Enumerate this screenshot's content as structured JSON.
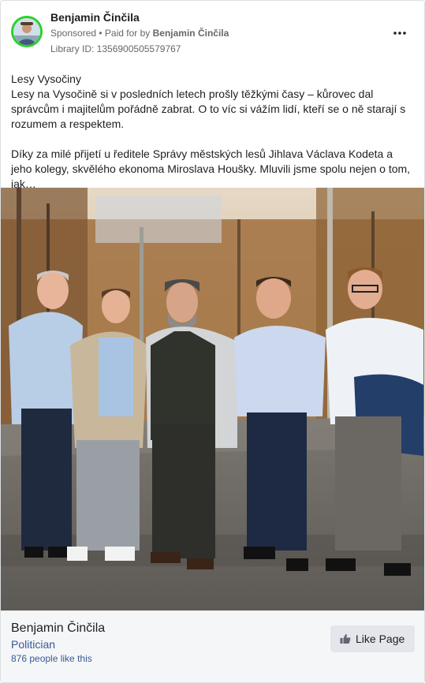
{
  "post": {
    "author": "Benjamin Činčila",
    "sponsored": "Sponsored",
    "separator": " • ",
    "paid_prefix": "Paid for by ",
    "paid_by": "Benjamin Činčila",
    "library_id": "Library ID: 1356900505579767",
    "text_title": "Lesy Vysočiny",
    "text_para1": "Lesy na Vysočině si v posledních letech prošly těžkými časy – kůrovec dal správcům i majitelům pořádně zabrat. O to víc si vážím lidí, kteří se o ně starají s rozumem a respektem.",
    "text_para2": "Díky za milé přijetí u ředitele Správy městských lesů Jihlava Václava Kodeta a jeho kolegy, skvělého ekonoma Miroslava Houšky. Mluvili jsme spolu nejen o tom, jak…"
  },
  "icons": {
    "more": "more-options-icon",
    "like": "thumbs-up-icon"
  },
  "footer": {
    "page_name": "Benjamin Činčila",
    "category": "Politician",
    "likes": "876 people like this",
    "like_button": "Like Page"
  },
  "colors": {
    "link": "#385898",
    "secondary": "#65676b",
    "avatar_ring": "#2bd12b"
  }
}
